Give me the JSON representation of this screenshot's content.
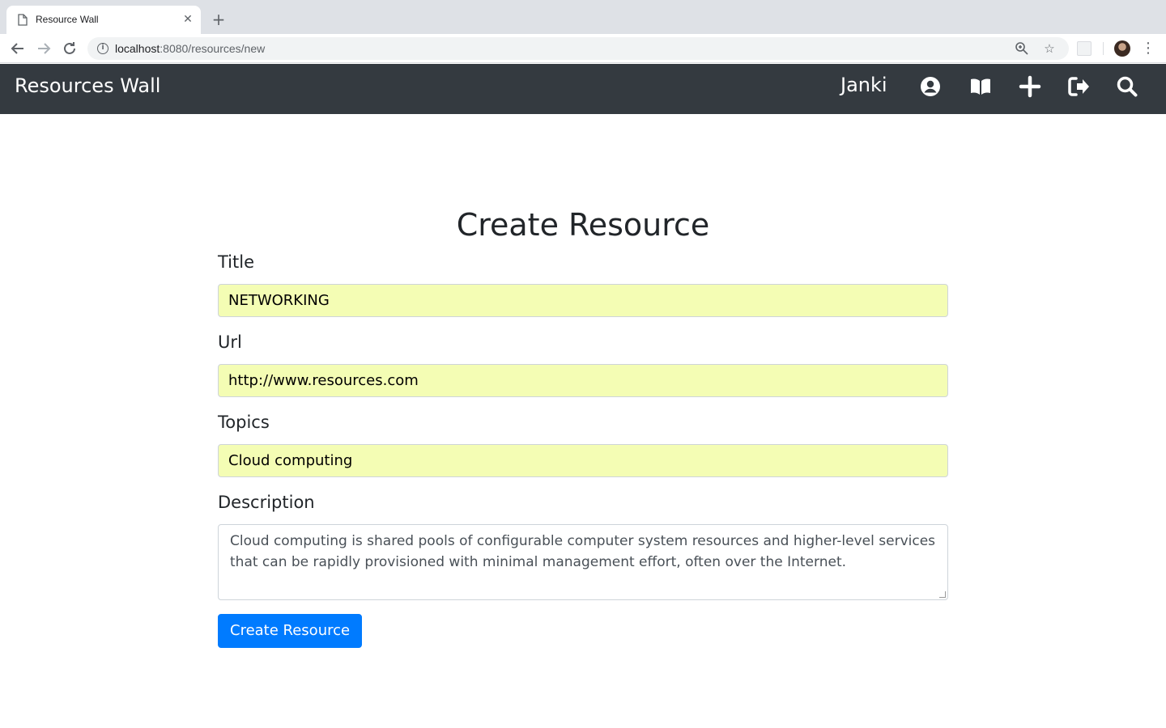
{
  "browser": {
    "tab_title": "Resource Wall",
    "url_host": "localhost",
    "url_rest": ":8080/resources/new"
  },
  "navbar": {
    "brand": "Resources Wall",
    "user": "Janki",
    "icons": [
      "user-circle-icon",
      "book-open-icon",
      "plus-icon",
      "sign-out-icon",
      "search-icon"
    ]
  },
  "form": {
    "heading": "Create Resource",
    "title_label": "Title",
    "title_value": "NETWORKING",
    "url_label": "Url",
    "url_value": "http://www.resources.com",
    "topics_label": "Topics",
    "topics_value": "Cloud computing",
    "description_label": "Description",
    "description_value": "Cloud computing is shared pools of configurable computer system resources and higher-level services that can be rapidly provisioned with minimal management effort, often over the Internet.",
    "submit_label": "Create Resource"
  },
  "colors": {
    "navbar_bg": "#343a40",
    "autofill_bg": "#f4fdb4",
    "primary": "#007bff"
  }
}
